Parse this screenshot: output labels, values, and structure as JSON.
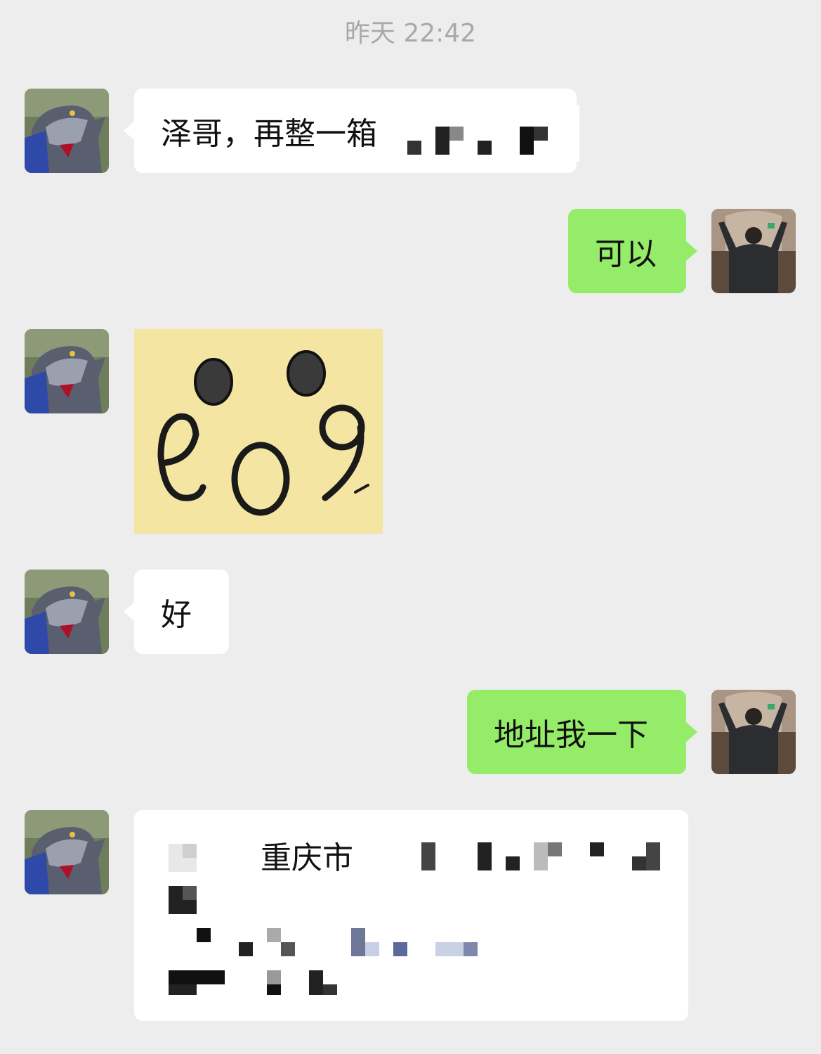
{
  "chat": {
    "timestamp": "昨天 22:42",
    "messages": [
      {
        "side": "in",
        "type": "text",
        "text": "泽哥，再整一箱"
      },
      {
        "side": "out",
        "type": "text",
        "text": "可以"
      },
      {
        "side": "in",
        "type": "sticker",
        "sticker_text": "eo9"
      },
      {
        "side": "in",
        "type": "text",
        "text": "好"
      },
      {
        "side": "out",
        "type": "text",
        "text": "地址我一下"
      },
      {
        "side": "in",
        "type": "text",
        "text": "重庆市"
      }
    ]
  },
  "colors": {
    "background": "#ededed",
    "incoming_bubble": "#ffffff",
    "outgoing_bubble": "#95ec69",
    "timestamp": "#a9a9a9",
    "sticker_bg": "#f4e6a2"
  },
  "icons": [
    "contact-avatar-robot-icon",
    "my-avatar-photo-icon"
  ]
}
